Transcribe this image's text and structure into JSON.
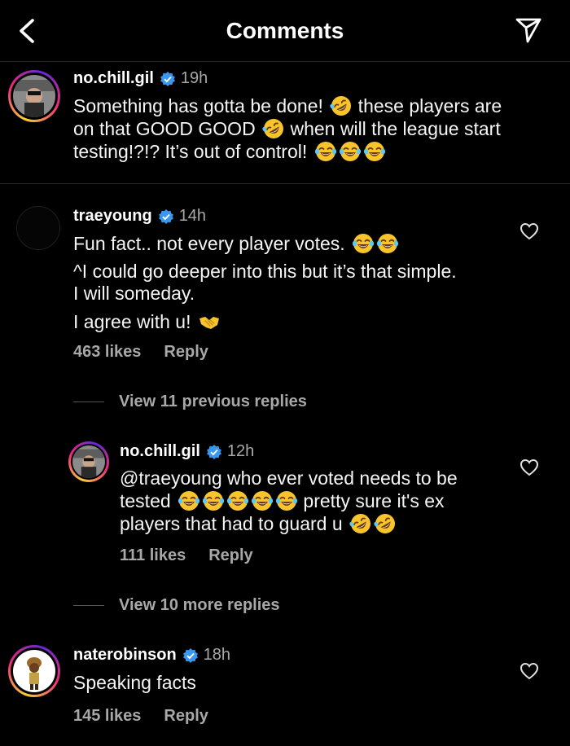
{
  "header": {
    "title": "Comments"
  },
  "caption": {
    "username": "no.chill.gil",
    "time": "19h",
    "lines": [
      {
        "text": "Something has gotta be done! ",
        "emoji": [
          "rolling-laughing"
        ],
        "tail": " these players are"
      },
      {
        "text": "on that GOOD GOOD ",
        "emoji": [
          "rolling-laughing"
        ],
        "tail": " when will the league start"
      },
      {
        "text": "testing!?!? It’s out of control! ",
        "emoji": [
          "tears-of-joy",
          "tears-of-joy",
          "tears-of-joy"
        ],
        "tail": ""
      }
    ]
  },
  "comments": [
    {
      "username": "traeyoung",
      "time": "14h",
      "paragraphs": [
        {
          "text": "Fun fact.. not every player votes. ",
          "emoji": [
            "tears-of-joy",
            "tears-of-joy"
          ]
        },
        {
          "text": "^I could go deeper into this but it’s that simple.",
          "line2": "I will someday."
        },
        {
          "text": "I agree with u! ",
          "emoji": [
            "handshake"
          ]
        }
      ],
      "likes": "463 likes",
      "reply": "Reply",
      "view_replies": "View 11 previous replies"
    },
    {
      "username": "no.chill.gil",
      "time": "12h",
      "line1": "@traeyoung who ever voted needs to be",
      "line2_start": "tested ",
      "line2_emoji": [
        "tears-of-joy",
        "tears-of-joy",
        "tears-of-joy",
        "tears-of-joy",
        "tears-of-joy"
      ],
      "line2_end": " pretty sure it's ex",
      "line3_start": "players that had to guard u ",
      "line3_emoji": [
        "rolling-laughing",
        "rolling-laughing"
      ],
      "likes": "111 likes",
      "reply": "Reply",
      "view_more": "View 10 more replies"
    },
    {
      "username": "naterobinson",
      "time": "18h",
      "text": "Speaking facts",
      "likes": "145 likes",
      "reply": "Reply"
    }
  ],
  "colors": {
    "background": "#000000",
    "text": "#f5f5f5",
    "secondary": "#a8a8a8",
    "verified": "#3897f0",
    "divider": "#262626"
  }
}
